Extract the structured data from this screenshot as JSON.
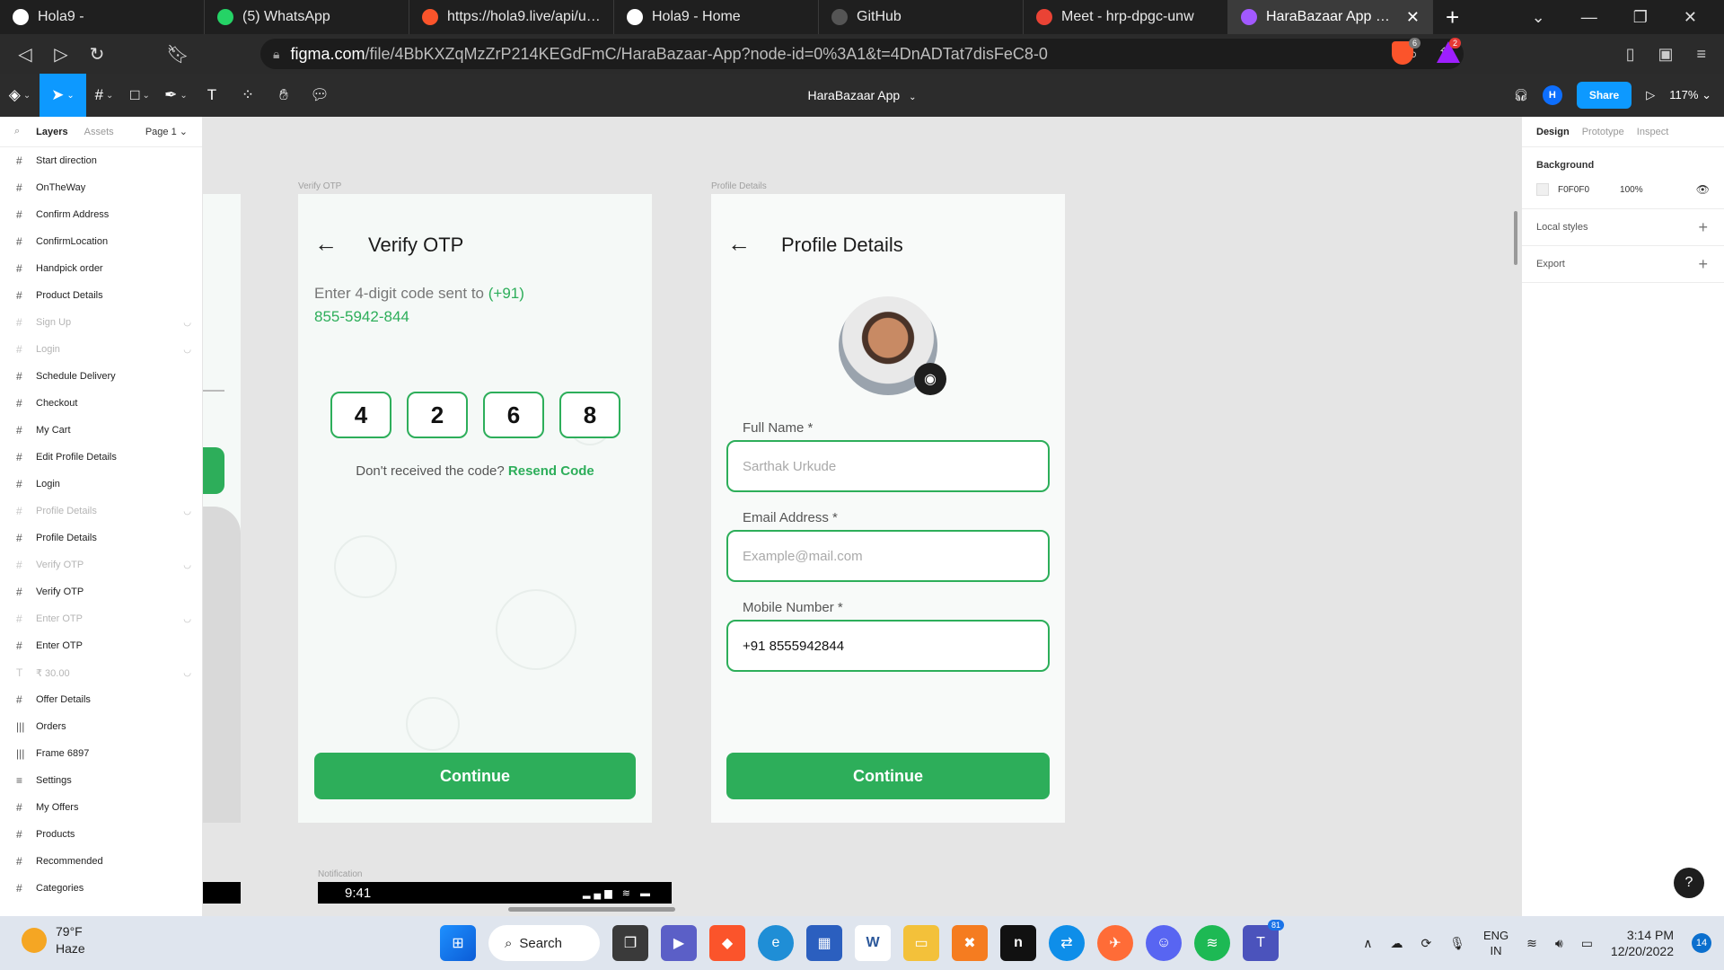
{
  "browser": {
    "tabs": [
      {
        "title": "Hola9 -",
        "icon": "globe-icon",
        "color": "#ffffff",
        "active": false
      },
      {
        "title": "(5) WhatsApp",
        "icon": "whatsapp-icon",
        "color": "#25d366",
        "active": false
      },
      {
        "title": "https://hola9.live/api/user/l",
        "icon": "link-icon",
        "color": "#fb542b",
        "active": false
      },
      {
        "title": "Hola9 - Home",
        "icon": "globe-icon",
        "color": "#ffffff",
        "active": false
      },
      {
        "title": "GitHub",
        "icon": "github-icon",
        "color": "#555555",
        "active": false
      },
      {
        "title": "Meet - hrp-dpgc-unw",
        "icon": "meet-icon",
        "color": "#ea4335",
        "active": false
      },
      {
        "title": "HaraBazaar App – Figm",
        "icon": "figma-icon",
        "color": "#a259ff",
        "active": true
      }
    ],
    "url_domain": "figma.com",
    "url_path": "/file/4BbKXZqMzZrP214KEGdFmC/HaraBazaar-App?node-id=0%3A1&t=4DnADTat7disFeC8-0",
    "brave_shield_count": "6",
    "brave_rewards_count": "2"
  },
  "figma": {
    "file_title": "HaraBazaar App",
    "share_label": "Share",
    "zoom": "117%",
    "user_initial": "H",
    "left_panel": {
      "tab_layers": "Layers",
      "tab_assets": "Assets",
      "page": "Page 1",
      "layers": [
        {
          "name": "Start direction",
          "icon": "#",
          "dim": false
        },
        {
          "name": "OnTheWay",
          "icon": "#",
          "dim": false
        },
        {
          "name": "Confirm Address",
          "icon": "#",
          "dim": false
        },
        {
          "name": "ConfirmLocation",
          "icon": "#",
          "dim": false
        },
        {
          "name": "Handpick order",
          "icon": "#",
          "dim": false
        },
        {
          "name": "Product Details",
          "icon": "#",
          "dim": false
        },
        {
          "name": "Sign Up",
          "icon": "#",
          "dim": true
        },
        {
          "name": "Login",
          "icon": "#",
          "dim": true
        },
        {
          "name": "Schedule Delivery",
          "icon": "#",
          "dim": false
        },
        {
          "name": "Checkout",
          "icon": "#",
          "dim": false
        },
        {
          "name": "My Cart",
          "icon": "#",
          "dim": false
        },
        {
          "name": "Edit Profile Details",
          "icon": "#",
          "dim": false
        },
        {
          "name": "Login",
          "icon": "#",
          "dim": false
        },
        {
          "name": "Profile Details",
          "icon": "#",
          "dim": true
        },
        {
          "name": "Profile Details",
          "icon": "#",
          "dim": false
        },
        {
          "name": "Verify OTP",
          "icon": "#",
          "dim": true
        },
        {
          "name": "Verify OTP",
          "icon": "#",
          "dim": false
        },
        {
          "name": "Enter OTP",
          "icon": "#",
          "dim": true
        },
        {
          "name": "Enter OTP",
          "icon": "#",
          "dim": false
        },
        {
          "name": "₹ 30.00",
          "icon": "T",
          "dim": true
        },
        {
          "name": "Offer Details",
          "icon": "#",
          "dim": false
        },
        {
          "name": "Orders",
          "icon": "|||",
          "dim": false
        },
        {
          "name": "Frame 6897",
          "icon": "|||",
          "dim": false
        },
        {
          "name": "Settings",
          "icon": "≡",
          "dim": false
        },
        {
          "name": "My Offers",
          "icon": "#",
          "dim": false
        },
        {
          "name": "Products",
          "icon": "#",
          "dim": false
        },
        {
          "name": "Recommended",
          "icon": "#",
          "dim": false
        },
        {
          "name": "Categories",
          "icon": "#",
          "dim": false
        }
      ]
    },
    "right_panel": {
      "tab_design": "Design",
      "tab_prototype": "Prototype",
      "tab_inspect": "Inspect",
      "background_title": "Background",
      "bg_hex": "F0F0F0",
      "bg_opacity": "100%",
      "local_styles": "Local styles",
      "export": "Export"
    },
    "canvas": {
      "verify_frame_label": "Verify OTP",
      "profile_frame_label": "Profile Details",
      "notification_label": "Notification",
      "verify": {
        "title": "Verify OTP",
        "instruction": "Enter 4-digit code sent to ",
        "phone_prefix": "(+91)",
        "phone": "855-5942-844",
        "digits": [
          "4",
          "2",
          "6",
          "8"
        ],
        "resend_prompt": "Don't received the code? ",
        "resend_link": "Resend Code",
        "continue": "Continue"
      },
      "profile": {
        "title": "Profile Details",
        "full_name_label": "Full Name *",
        "full_name_placeholder": "Sarthak Urkude",
        "email_label": "Email Address *",
        "email_placeholder": "Example@mail.com",
        "mobile_label": "Mobile Number *",
        "mobile_value": "+91 8555942844",
        "continue": "Continue"
      },
      "status_time": "9:41",
      "accent": "#2dae5a"
    }
  },
  "taskbar": {
    "temp": "79°F",
    "condition": "Haze",
    "search": "Search",
    "lang1": "ENG",
    "lang2": "IN",
    "time": "3:14 PM",
    "date": "12/20/2022",
    "notifications": "14",
    "teamviewer_badge": "81"
  }
}
